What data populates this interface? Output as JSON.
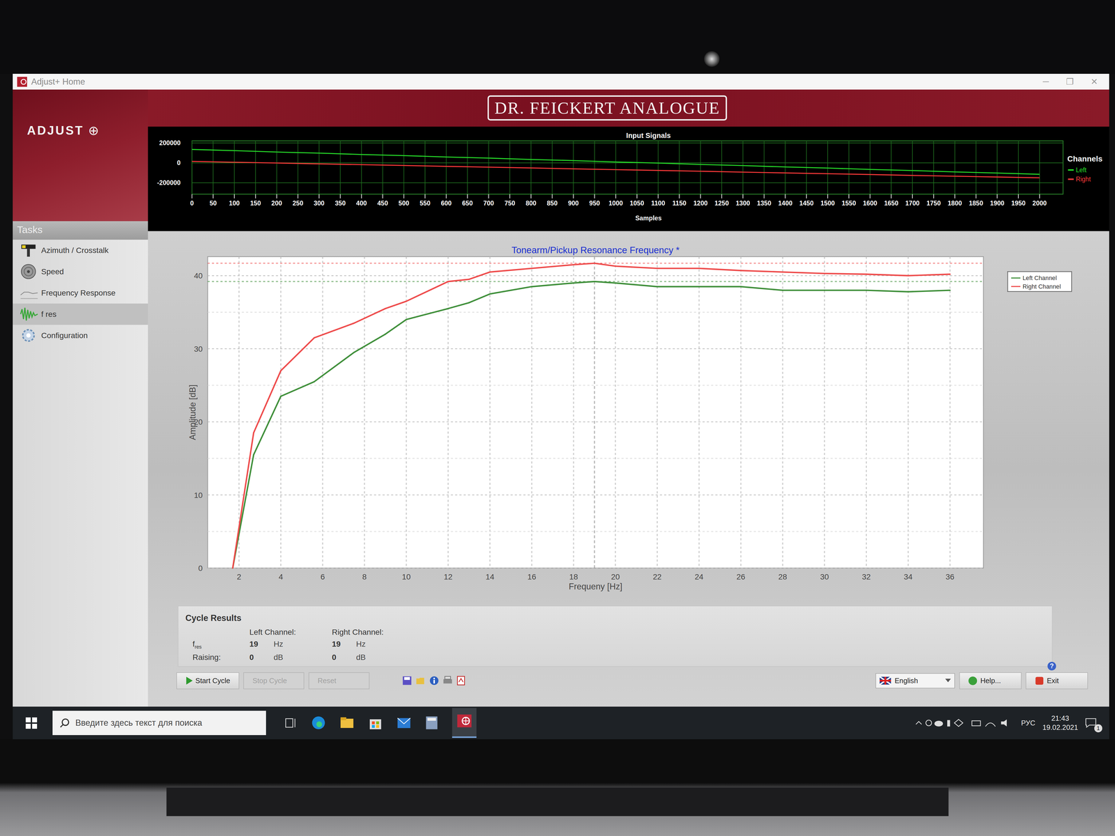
{
  "window": {
    "title": "Adjust+ Home",
    "controls": [
      "─",
      "❐",
      "✕"
    ]
  },
  "app": {
    "logo": "ADJUST",
    "logo_mark": "⊕",
    "banner": "DR. FEICKERT ANALOGUE"
  },
  "input_signals": {
    "title": "Input Signals",
    "y_ticks": [
      "200000",
      "0",
      "-200000"
    ],
    "x_ticks": [
      "0",
      "50",
      "100",
      "150",
      "200",
      "250",
      "300",
      "350",
      "400",
      "450",
      "500",
      "550",
      "600",
      "650",
      "700",
      "750",
      "800",
      "850",
      "900",
      "950",
      "1000",
      "1050",
      "1100",
      "1150",
      "1200",
      "1250",
      "1300",
      "1350",
      "1400",
      "1450",
      "1500",
      "1550",
      "1600",
      "1650",
      "1700",
      "1750",
      "1800",
      "1850",
      "1900",
      "1950",
      "2000"
    ],
    "x_label": "Samples",
    "legend_title": "Channels",
    "samples": [
      0,
      100,
      200,
      300,
      400,
      500,
      600,
      700,
      800,
      900,
      1000,
      1100,
      1200,
      1300,
      1400,
      1500,
      1600,
      1700,
      1800,
      1900,
      2000
    ],
    "series": [
      {
        "name": "Left",
        "color": "#27e02a",
        "values": [
          135000,
          123000,
          109000,
          98000,
          84000,
          73000,
          59000,
          48000,
          34000,
          23000,
          9000,
          -2000,
          -16000,
          -27000,
          -41000,
          -52000,
          -66000,
          -77000,
          -91000,
          -102000,
          -115000
        ]
      },
      {
        "name": "Right",
        "color": "#ff3a3a",
        "values": [
          15000,
          6500,
          -1500,
          -10000,
          -18000,
          -26000,
          -35000,
          -43000,
          -51000,
          -60000,
          -68000,
          -76000,
          -84000,
          -93000,
          -101000,
          -109000,
          -117000,
          -126000,
          -134000,
          -142000,
          -150000
        ]
      }
    ]
  },
  "sidebar": {
    "title": "Tasks",
    "items": [
      {
        "label": "Azimuth / Crosstalk",
        "selected": false
      },
      {
        "label": "Speed",
        "selected": false
      },
      {
        "label": "Frequency Response",
        "selected": false
      },
      {
        "label": "f res",
        "selected": true
      },
      {
        "label": "Configuration",
        "selected": false
      }
    ]
  },
  "chart": {
    "title": "Tonearm/Pickup Resonance Frequency *",
    "y_label": "Amplitude [dB]",
    "x_label": "Frequeny [Hz]",
    "y_ticks": [
      "0",
      "10",
      "20",
      "30",
      "40"
    ],
    "x_ticks": [
      "2",
      "4",
      "6",
      "8",
      "10",
      "12",
      "14",
      "16",
      "18",
      "20",
      "22",
      "24",
      "26",
      "28",
      "30",
      "32",
      "34",
      "36"
    ],
    "frequencies": [
      1.7,
      2.7,
      4,
      5.6,
      7.5,
      9,
      10,
      12,
      13,
      14,
      16,
      18,
      19,
      20,
      22,
      24,
      26,
      28,
      30,
      32,
      34,
      36
    ],
    "series": [
      {
        "name": "Left Channel",
        "color": "#3f8f3a",
        "values": [
          0,
          15.5,
          23.5,
          25.5,
          29.5,
          32,
          34,
          35.5,
          36.3,
          37.5,
          38.5,
          39,
          39.2,
          39,
          38.5,
          38.5,
          38.5,
          38,
          38,
          38,
          37.8,
          38
        ]
      },
      {
        "name": "Right Channel",
        "color": "#ee4b4b",
        "values": [
          0,
          18.5,
          27,
          31.5,
          33.5,
          35.5,
          36.5,
          39.2,
          39.5,
          40.5,
          41,
          41.5,
          41.7,
          41.3,
          41,
          41,
          40.7,
          40.5,
          40.3,
          40.2,
          40,
          40.2
        ]
      }
    ]
  },
  "results": {
    "title": "Cycle Results",
    "columns": [
      "Left Channel:",
      "Right Channel:"
    ],
    "rows": [
      {
        "label": "f",
        "sub": "res",
        "left": "19",
        "right": "19",
        "unit": "Hz"
      },
      {
        "label": "Raising:",
        "sub": "",
        "left": "0",
        "right": "0",
        "unit": "dB"
      }
    ],
    "info_glyph": "?"
  },
  "buttons": [
    {
      "label": "Start Cycle",
      "disabled": false
    },
    {
      "label": "Stop Cycle",
      "disabled": true
    },
    {
      "label": "Reset",
      "disabled": true
    }
  ],
  "language": {
    "value": "English"
  },
  "help": "Help...",
  "exit": "Exit",
  "taskbar": {
    "search": "Введите здесь текст для поиска",
    "lang": "РУС",
    "time": "21:43",
    "date": "19.02.2021",
    "notifications": "1"
  }
}
